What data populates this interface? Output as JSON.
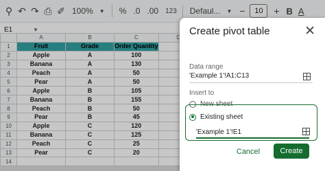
{
  "toolbar": {
    "zoom": "100%",
    "percent": "%",
    "decimal_dec": ".0",
    "decimal_inc": ".00",
    "number_format": "123",
    "font": "Defaul...",
    "font_size": "10",
    "bold": "B",
    "text_color": "A"
  },
  "formula_bar": {
    "cell_ref": "E1"
  },
  "sheet": {
    "columns": [
      "A",
      "B",
      "C",
      "D"
    ],
    "row_numbers": [
      "1",
      "2",
      "3",
      "4",
      "5",
      "6",
      "7",
      "8",
      "9",
      "10",
      "11",
      "12",
      "13",
      "14"
    ],
    "header": [
      "Fruit",
      "Grade",
      "Order Quantity"
    ],
    "rows": [
      [
        "Apple",
        "A",
        "100"
      ],
      [
        "Banana",
        "A",
        "130"
      ],
      [
        "Peach",
        "A",
        "50"
      ],
      [
        "Pear",
        "A",
        "50"
      ],
      [
        "Apple",
        "B",
        "105"
      ],
      [
        "Banana",
        "B",
        "155"
      ],
      [
        "Peach",
        "B",
        "50"
      ],
      [
        "Pear",
        "B",
        "45"
      ],
      [
        "Apple",
        "C",
        "120"
      ],
      [
        "Banana",
        "C",
        "125"
      ],
      [
        "Peach",
        "C",
        "25"
      ],
      [
        "Pear",
        "C",
        "20"
      ]
    ],
    "header_color": "#33a3a4"
  },
  "dialog": {
    "title": "Create pivot table",
    "data_range_label": "Data range",
    "data_range_value": "'Example 1'!A1:C13",
    "insert_to_label": "Insert to",
    "new_sheet_label": "New sheet",
    "existing_sheet_label": "Existing sheet",
    "existing_sheet_value": "'Example 1'!E1",
    "cancel_label": "Cancel",
    "create_label": "Create",
    "accent_color": "#146c2e"
  }
}
